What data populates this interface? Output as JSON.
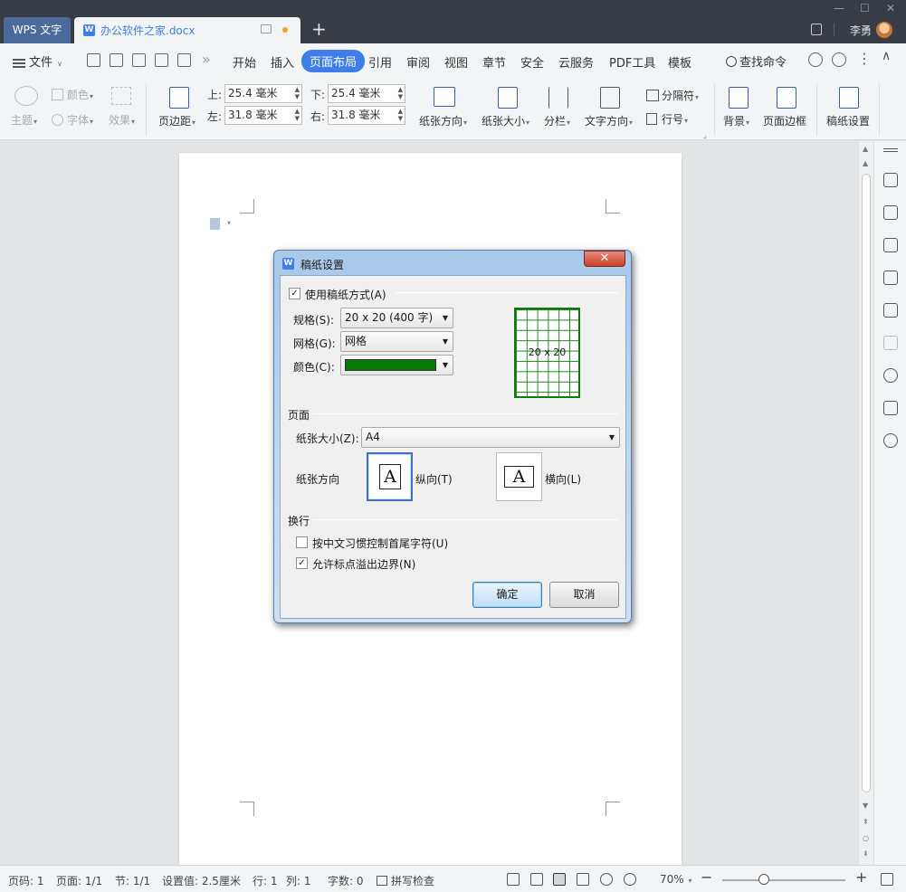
{
  "titlebar": {
    "app_tab": "WPS 文字",
    "doc_tab": "办公软件之家.docx",
    "user": "李勇"
  },
  "menubar": {
    "file": "文件",
    "tabs": [
      "开始",
      "插入",
      "页面布局",
      "引用",
      "审阅",
      "视图",
      "章节",
      "安全",
      "云服务",
      "PDF工具",
      "模板"
    ],
    "active_tab": "页面布局",
    "search": "查找命令"
  },
  "ribbon": {
    "theme": "主题",
    "color": "颜色",
    "font": "字体",
    "effect": "效果",
    "margins": "页边距",
    "top_label": "上:",
    "top_value": "25.4 毫米",
    "bottom_label": "下:",
    "bottom_value": "25.4 毫米",
    "left_label": "左:",
    "left_value": "31.8 毫米",
    "right_label": "右:",
    "right_value": "31.8 毫米",
    "orientation": "纸张方向",
    "paper_size": "纸张大小",
    "columns": "分栏",
    "text_direction": "文字方向",
    "breaks": "分隔符",
    "line_numbers": "行号",
    "background": "背景",
    "page_border": "页面边框",
    "manuscript": "稿纸设置"
  },
  "dialog": {
    "title": "稿纸设置",
    "use_manuscript": "使用稿纸方式(A)",
    "use_manuscript_checked": true,
    "spec_label": "规格(S):",
    "spec_value": "20 x 20 (400 字)",
    "grid_label": "网格(G):",
    "grid_value": "网格",
    "color_label": "颜色(C):",
    "color_value": "#047a04",
    "preview_text": "20 x 20",
    "page_section": "页面",
    "paper_size_label": "纸张大小(Z):",
    "paper_size_value": "A4",
    "orientation_label": "纸张方向",
    "portrait": "纵向(T)",
    "landscape": "横向(L)",
    "selected_orientation": "portrait",
    "glyph": "A",
    "wrap_section": "换行",
    "wrap_rule": "按中文习惯控制首尾字符(U)",
    "wrap_rule_checked": false,
    "allow_overflow": "允许标点溢出边界(N)",
    "allow_overflow_checked": true,
    "ok": "确定",
    "cancel": "取消"
  },
  "statusbar": {
    "page_num": "页码: 1",
    "pages": "页面: 1/1",
    "section": "节: 1/1",
    "setting": "设置值: 2.5厘米",
    "row": "行: 1",
    "col": "列: 1",
    "words": "字数: 0",
    "spell": "拼写检查",
    "zoom": "70%"
  }
}
